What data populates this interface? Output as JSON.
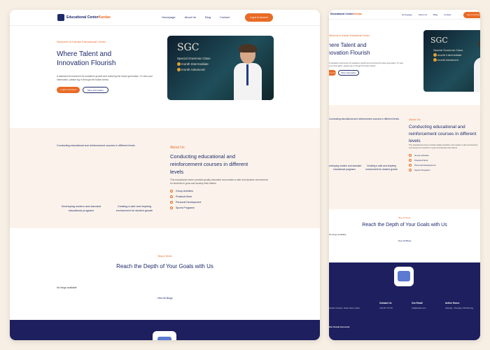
{
  "brand": {
    "name_a": "Educational Center",
    "name_b": "Kardan"
  },
  "nav": {
    "links": [
      "Homepage",
      "About Us",
      "Blog",
      "Contact"
    ],
    "login": "Log in to Account"
  },
  "hero": {
    "welcome": "Welcome to Kardan Educational Center",
    "title": "Where Talent and Innovation Flourish",
    "description": "A standard environment for academic growth and nurturing the future generation. To view your information, please log in through the button below.",
    "btn_login": "Login to Account",
    "btn_more": "More Information"
  },
  "banner": {
    "logo": "SGC",
    "subtitle": "Special Grammar Class",
    "line1": "month Intermediate",
    "line2": "month Advanced",
    "dot1": "1",
    "dot2": "3"
  },
  "section2": {
    "image_caption": "Conducting educational and reinforcement courses in different levels",
    "tag": "About Us",
    "title": "Conducting educational and reinforcement courses in different levels",
    "description": "This educational center provides quality education and creates a safe and dynamic environment for students to grow and develop their talents.",
    "features": [
      "Group Activities",
      "Practical Work",
      "Personal Development",
      "Sports Programs"
    ],
    "card1": "Developing modern and standard educational programs",
    "card2": "Creating a safe and inspiring environment for student growth"
  },
  "section3": {
    "tag": "Blog & News",
    "title": "Reach the Depth of Your Goals with Us",
    "no_blogs": "No blogs available",
    "view_all": "View All Blogs"
  },
  "footer": {
    "col1_sub": "Kardan Complex, Sultan Street, Kabul",
    "contact_title": "Contact Us",
    "contact_sub": "+93 78 4 757 00",
    "email_title": "Our Email",
    "email_sub": "info@kardan.com",
    "hours_title": "Active Hours",
    "hours_sub": "Saturday - Thursday, 8:00 Morning",
    "social": "Our Social Accounts"
  },
  "colors": {
    "accent": "#e86b26",
    "primary": "#1f2a6b",
    "footer": "#1e1f5e",
    "section_bg": "#fbf3eb",
    "page_bg": "#f7efe4"
  }
}
